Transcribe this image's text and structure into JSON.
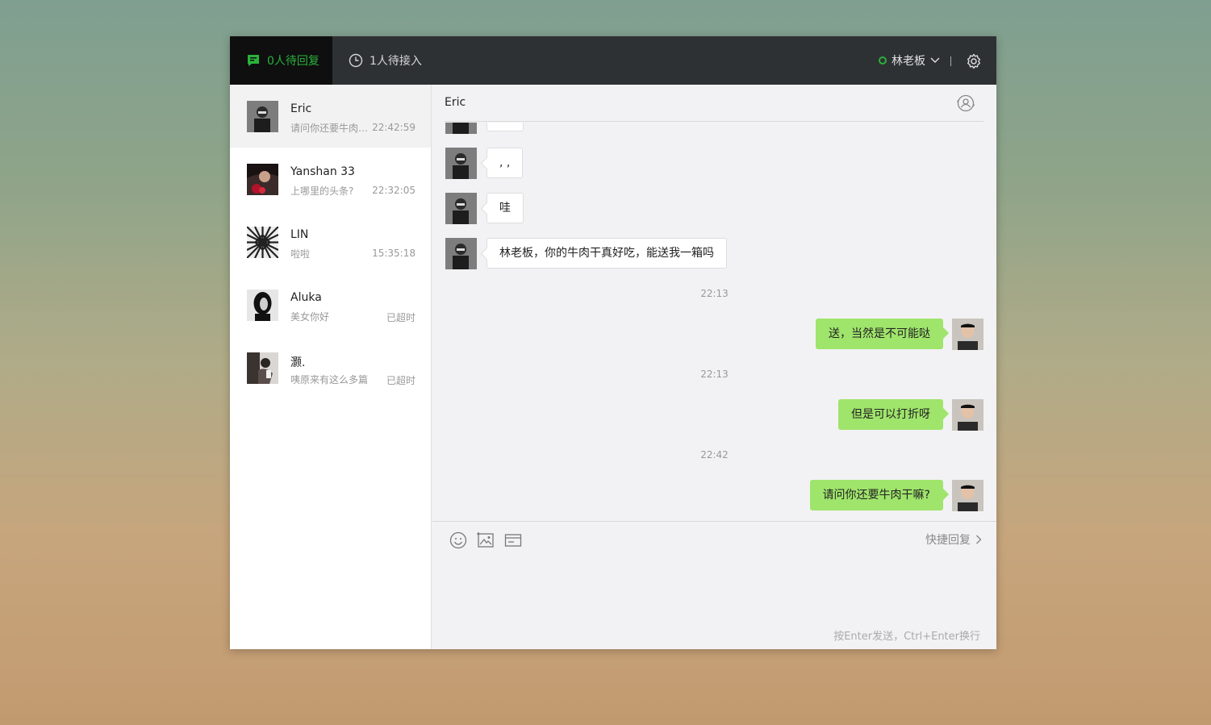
{
  "topbar": {
    "tab_pending_reply": "0人待回复",
    "tab_waiting": "1人待接入",
    "agent_name": "林老板",
    "accent_color": "#2ab13a"
  },
  "conversations": [
    {
      "name": "Eric",
      "preview": "请问你还要牛肉干嘛?",
      "time": "22:42:59"
    },
    {
      "name": "Yanshan 33",
      "preview": "上哪里的头条?",
      "time": "22:32:05"
    },
    {
      "name": "LIN",
      "preview": "啦啦",
      "time": "15:35:18"
    },
    {
      "name": "Aluka",
      "preview": "美女你好",
      "time": "已超时"
    },
    {
      "name": "灏.",
      "preview": "咦原来有这么多篇",
      "time": "已超时"
    }
  ],
  "chat": {
    "title": "Eric",
    "messages_left": [
      ",  ,",
      "哇",
      "林老板，你的牛肉干真好吃，能送我一箱吗"
    ],
    "time_1": "22:13",
    "reply_1": "送，当然是不可能哒",
    "time_2": "22:13",
    "reply_2": "但是可以打折呀",
    "time_3": "22:42",
    "reply_3": "请问你还要牛肉干嘛?"
  },
  "composer": {
    "quick_reply": "快捷回复",
    "hint": "按Enter发送，Ctrl+Enter换行"
  }
}
